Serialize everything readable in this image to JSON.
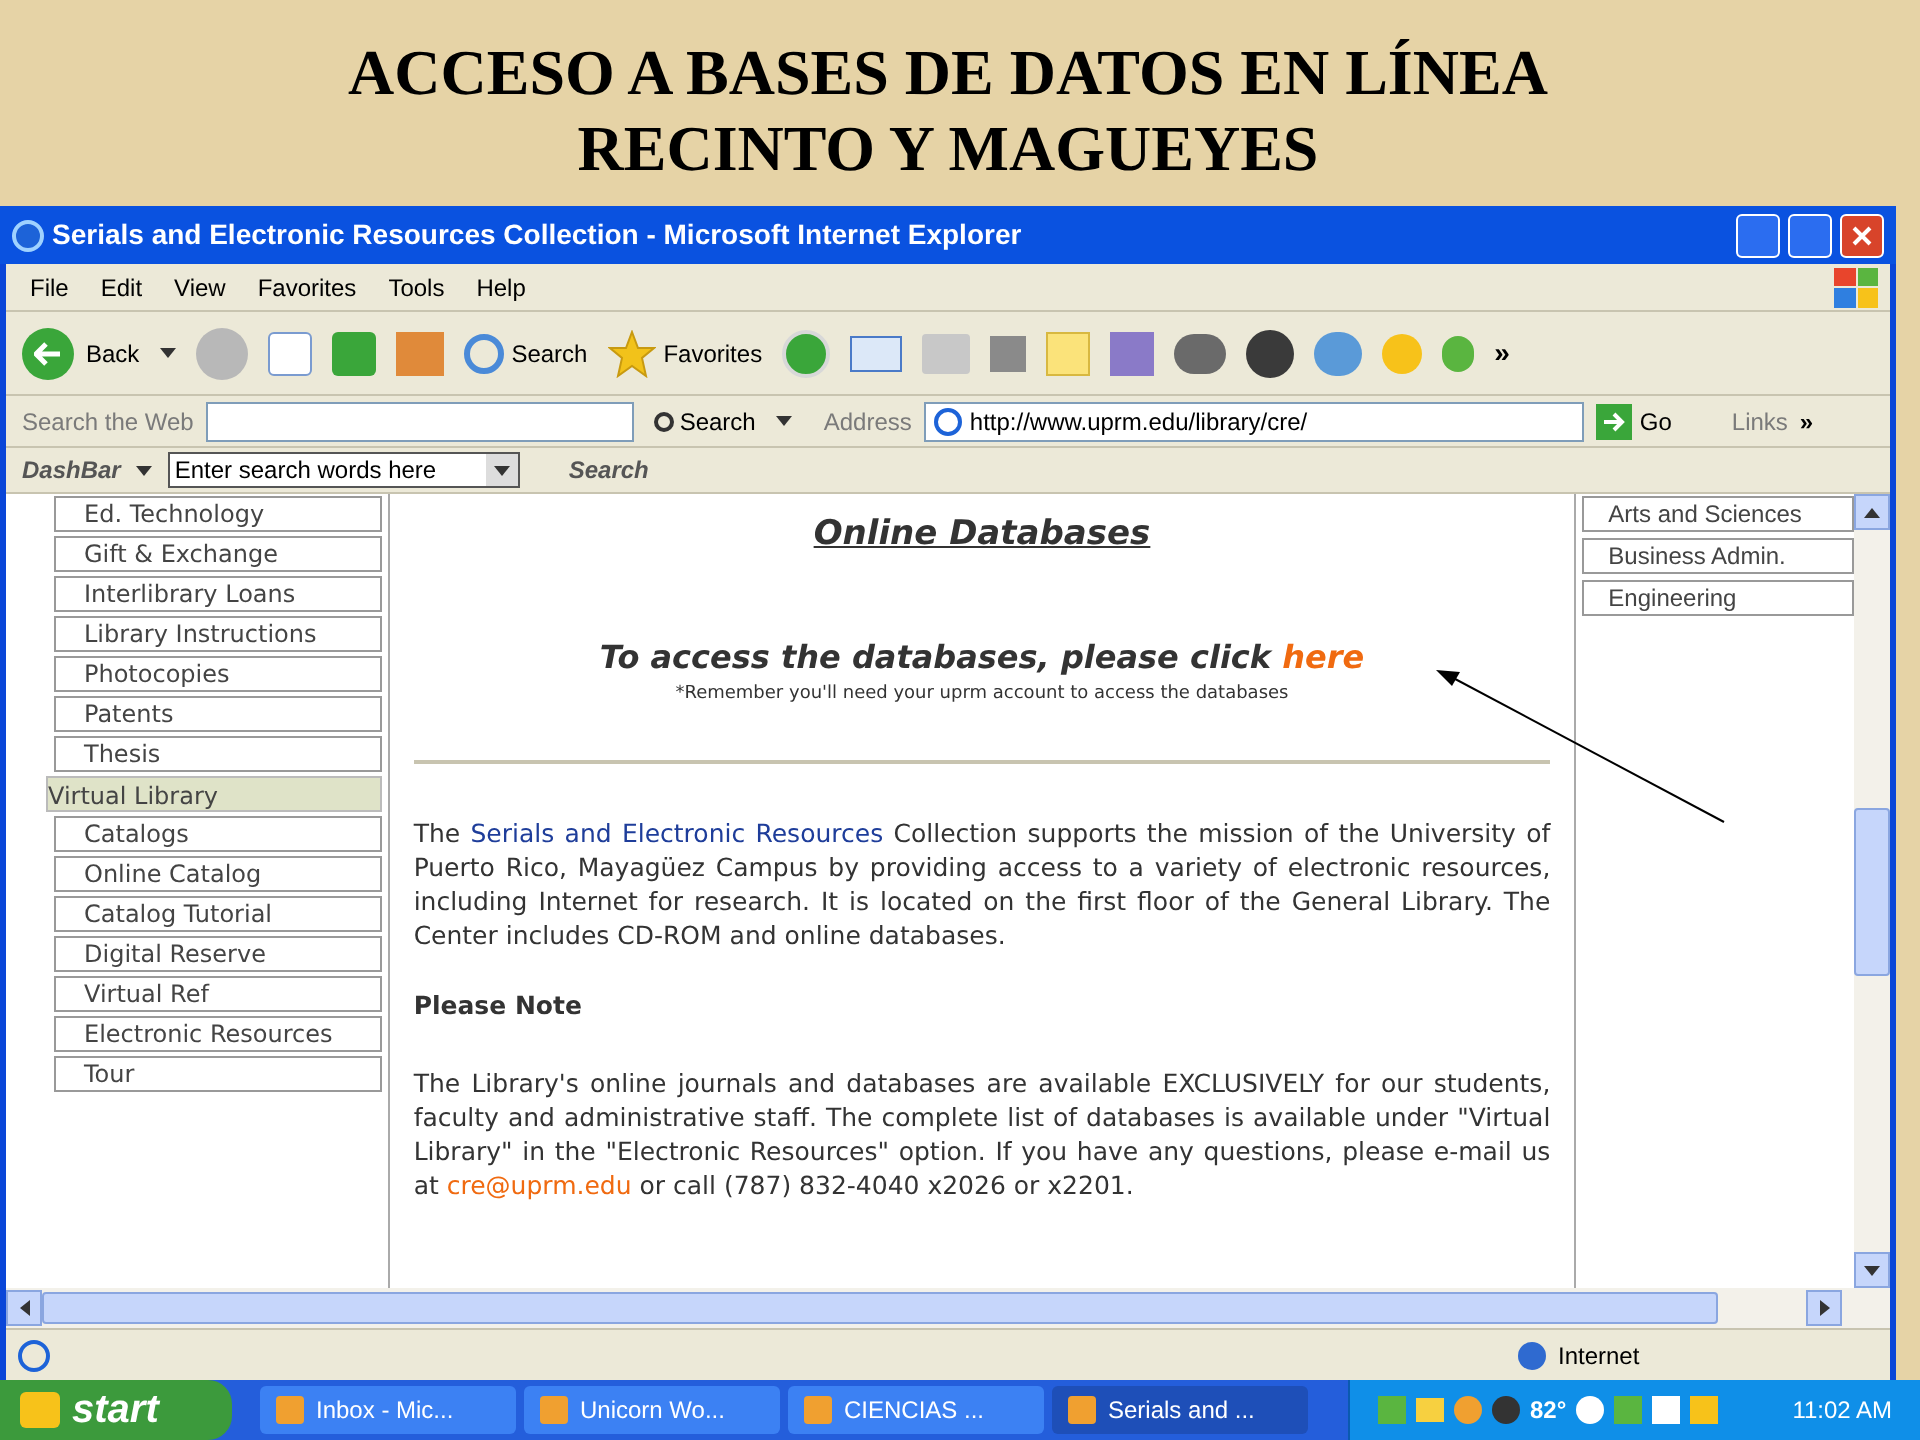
{
  "slide_title": [
    "ACCESO A BASES DE DATOS EN LÍNEA",
    "RECINTO Y MAGUEYES"
  ],
  "window": {
    "title": "Serials and Electronic Resources Collection - Microsoft Internet Explorer"
  },
  "menu": [
    "File",
    "Edit",
    "View",
    "Favorites",
    "Tools",
    "Help"
  ],
  "toolbar": {
    "back": "Back",
    "search": "Search",
    "favorites": "Favorites",
    "more": "»"
  },
  "links_bar": {
    "search_label": "Search the Web",
    "search_button": "Search",
    "address_label": "Address",
    "url": "http://www.uprm.edu/library/cre/",
    "go": "Go",
    "links": "Links",
    "more": "»"
  },
  "dashbar": {
    "label": "DashBar",
    "value": "Enter search words here",
    "search": "Search"
  },
  "sidebar": {
    "items": [
      {
        "label": "Ed. Technology",
        "kind": "link"
      },
      {
        "label": "Gift & Exchange",
        "kind": "link"
      },
      {
        "label": "Interlibrary Loans",
        "kind": "link"
      },
      {
        "label": "Library Instructions",
        "kind": "link"
      },
      {
        "label": "Photocopies",
        "kind": "link"
      },
      {
        "label": "Patents",
        "kind": "link"
      },
      {
        "label": "Thesis",
        "kind": "link"
      },
      {
        "label": "Virtual Library",
        "kind": "section"
      },
      {
        "label": "Catalogs",
        "kind": "link"
      },
      {
        "label": "Online Catalog",
        "kind": "link"
      },
      {
        "label": "Catalog Tutorial",
        "kind": "link"
      },
      {
        "label": "Digital Reserve",
        "kind": "link"
      },
      {
        "label": "Virtual Ref",
        "kind": "link"
      },
      {
        "label": "Electronic Resources",
        "kind": "link"
      },
      {
        "label": "Tour",
        "kind": "link"
      }
    ]
  },
  "main": {
    "heading": "Online Databases",
    "access_text": "To access the databases, please click",
    "access_link": "here",
    "reminder": "*Remember you'll need your uprm account to access the databases",
    "intro_prefix": "The",
    "intro_link": "Serials and Electronic Resources",
    "intro_rest": "Collection supports the mission of the University of Puerto Rico, Mayagüez Campus by providing access to a variety of electronic resources, including Internet for research. It is located on the first floor of the General Library. The Center includes CD-ROM and online databases.",
    "note_heading": "Please Note",
    "note_text": "The Library's online journals and databases are available EXCLUSIVELY for our students, faculty and administrative staff. The complete list of databases is available under \"Virtual Library\" in the \"Electronic Resources\" option. If you have any questions, please e-mail us at",
    "note_email": "cre@uprm.edu",
    "note_rest": "or call (787) 832-4040 x2026 or x2201."
  },
  "right_column": [
    "Arts and Sciences",
    "Business Admin.",
    "Engineering"
  ],
  "status_bar": {
    "zone": "Internet"
  },
  "taskbar": {
    "start": "start",
    "tasks": [
      {
        "label": "Inbox - Mic...",
        "selected": false
      },
      {
        "label": "Unicorn Wo...",
        "selected": false
      },
      {
        "label": "CIENCIAS ...",
        "selected": false
      },
      {
        "label": "Serials and ...",
        "selected": true
      }
    ],
    "temperature": "82°",
    "clock": "11:02 AM"
  }
}
